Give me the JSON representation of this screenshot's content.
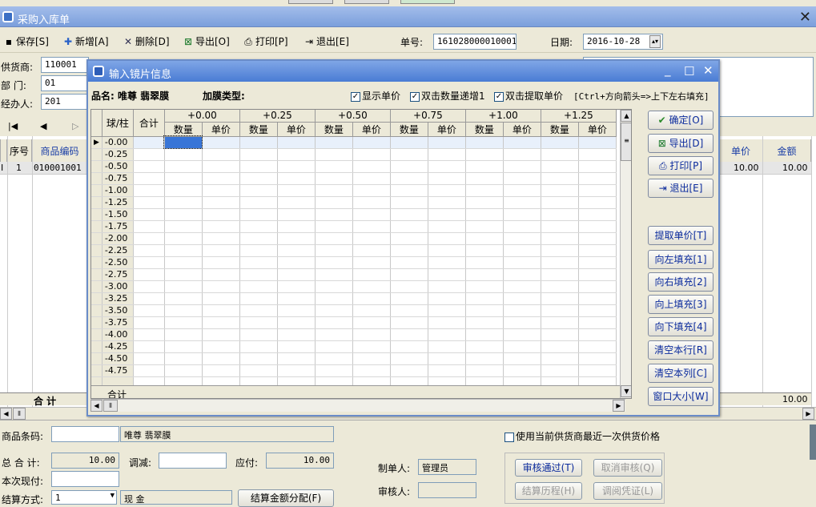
{
  "main": {
    "title": "采购入库单",
    "toolbar": {
      "save": "保存[S]",
      "add": "新增[A]",
      "delete": "删除[D]",
      "export": "导出[O]",
      "print": "打印[P]",
      "exit": "退出[E]",
      "order_no_label": "单号:",
      "order_no": "161028000010001",
      "date_label": "日期:",
      "date": "2016-10-28"
    },
    "form": {
      "supplier_label": "供货商:",
      "supplier": "110001",
      "dept_label": "部  门:",
      "dept": "01",
      "handler_label": "经办人:",
      "handler": "201"
    },
    "grid": {
      "columns": [
        "序号",
        "商品编码",
        "单价",
        "金额"
      ],
      "rows": [
        {
          "no": "1",
          "code": "010001001",
          "price": "10.00",
          "amount": "10.00"
        }
      ],
      "total_label": "合  计",
      "total_amount": "10.00"
    },
    "bottom": {
      "barcode_label": "商品条码:",
      "product_name": "唯尊 翡翠膜",
      "use_supplier_price": "使用当前供货商最近一次供货价格",
      "total_label": "总 合 计:",
      "total": "10.00",
      "adjust_label": "调减:",
      "payable_label": "应付:",
      "payable": "10.00",
      "paid_label": "本次现付:",
      "settle_label": "结算方式:",
      "settle_code": "1",
      "settle_name": "现  金",
      "allocate_button": "结算金额分配(F)",
      "maker_label": "制单人:",
      "maker": "管理员",
      "auditor_label": "审核人:",
      "approve_button": "审核通过(T)",
      "cancel_audit_button": "取消审核(Q)",
      "history_button": "结算历程(H)",
      "voucher_button": "调阅凭证(L)"
    }
  },
  "dialog": {
    "title": "输入镜片信息",
    "product_label": "品名: 唯尊 翡翠膜",
    "coating_label": "加膜类型:",
    "options": [
      {
        "label": "显示单价",
        "checked": true
      },
      {
        "label": "双击数量递增1",
        "checked": true
      },
      {
        "label": "双击提取单价",
        "checked": true
      }
    ],
    "hint": "[Ctrl+方向箭头=>上下左右填充]",
    "corner_header": "球/柱",
    "sum_header": "合计",
    "cyl_headers": [
      "+0.00",
      "+0.25",
      "+0.50",
      "+0.75",
      "+1.00",
      "+1.25"
    ],
    "sub_headers": [
      "数量",
      "单价"
    ],
    "sph_rows": [
      "-0.00",
      "-0.25",
      "-0.50",
      "-0.75",
      "-1.00",
      "-1.25",
      "-1.50",
      "-1.75",
      "-2.00",
      "-2.25",
      "-2.50",
      "-2.75",
      "-3.00",
      "-3.25",
      "-3.50",
      "-3.75",
      "-4.00",
      "-4.25",
      "-4.50",
      "-4.75"
    ],
    "footer_label": "合计",
    "buttons": {
      "confirm": "确定[O]",
      "export": "导出[D]",
      "print": "打印[P]",
      "exit": "退出[E]",
      "fetch_price": "提取单价[T]",
      "fill_left": "向左填充[1]",
      "fill_right": "向右填充[2]",
      "fill_up": "向上填充[3]",
      "fill_down": "向下填充[4]",
      "clear_row": "清空本行[R]",
      "clear_col": "清空本列[C]",
      "window_size": "窗口大小[W]"
    }
  }
}
